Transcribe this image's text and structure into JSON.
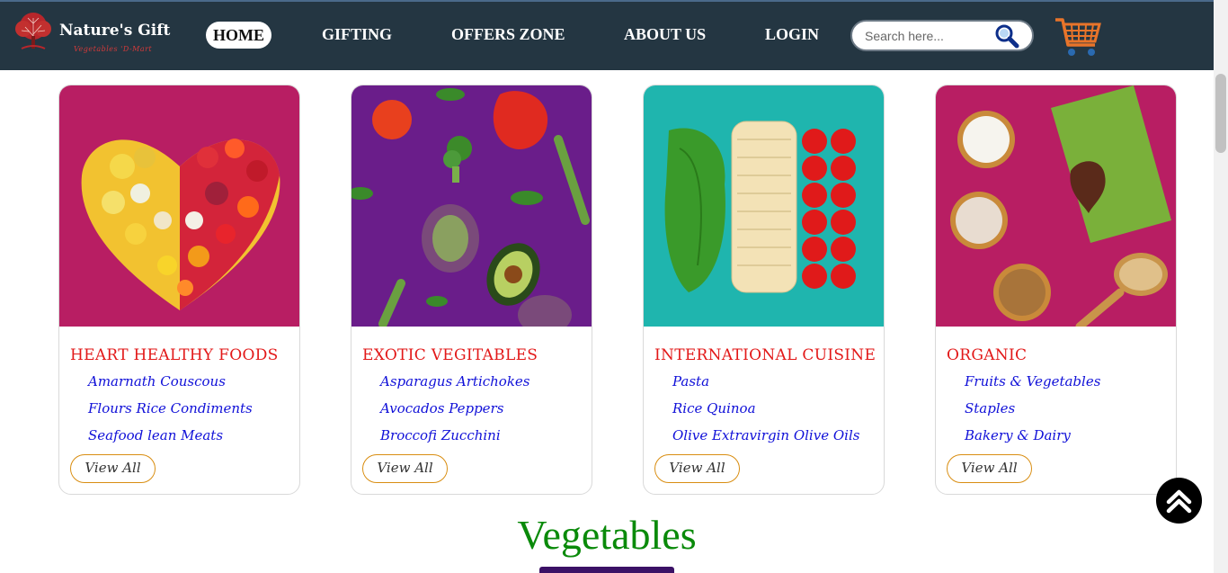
{
  "brand": {
    "name": "Nature's Gift",
    "tagline": "Vegetables 'D-Mart"
  },
  "nav": {
    "items": [
      {
        "label": "HOME",
        "active": true
      },
      {
        "label": "GIFTING",
        "active": false
      },
      {
        "label": "OFFERS ZONE",
        "active": false
      },
      {
        "label": "ABOUT US",
        "active": false
      },
      {
        "label": "LOGIN",
        "active": false
      }
    ]
  },
  "search": {
    "placeholder": "Search here...",
    "value": "",
    "icon": "magnifier-icon"
  },
  "cart": {
    "icon": "cart-icon",
    "color": "#e8742a"
  },
  "cards": [
    {
      "title": "HEART HEALTHY FOODS",
      "links": [
        "Amarnath Couscous",
        "Flours Rice Condiments",
        "Seafood lean Meats"
      ],
      "button": "View All",
      "bg_color": "#b81e63"
    },
    {
      "title": "EXOTIC VEGITABLES",
      "links": [
        "Asparagus Artichokes",
        "Avocados Peppers",
        "Broccofi Zucchini"
      ],
      "button": "View All",
      "bg_color": "#6a1d8a"
    },
    {
      "title": "INTERNATIONAL CUISINE",
      "links": [
        "Pasta",
        "Rice Quinoa",
        "Olive Extravirgin Olive Oils"
      ],
      "button": "View All",
      "bg_color": "#1fb5ae"
    },
    {
      "title": "ORGANIC",
      "links": [
        "Fruits & Vegetables",
        "Staples",
        "Bakery & Dairy"
      ],
      "button": "View All",
      "bg_color": "#b81e63"
    }
  ],
  "section": {
    "heading": "Vegetables"
  },
  "scroll_top": {
    "icon": "double-chevron-up-icon"
  },
  "colors": {
    "navbar": "#243642",
    "title_red": "#e21818",
    "link_blue": "#1010d8",
    "heading_green": "#0a8a0a",
    "button_border": "#d98e12"
  }
}
